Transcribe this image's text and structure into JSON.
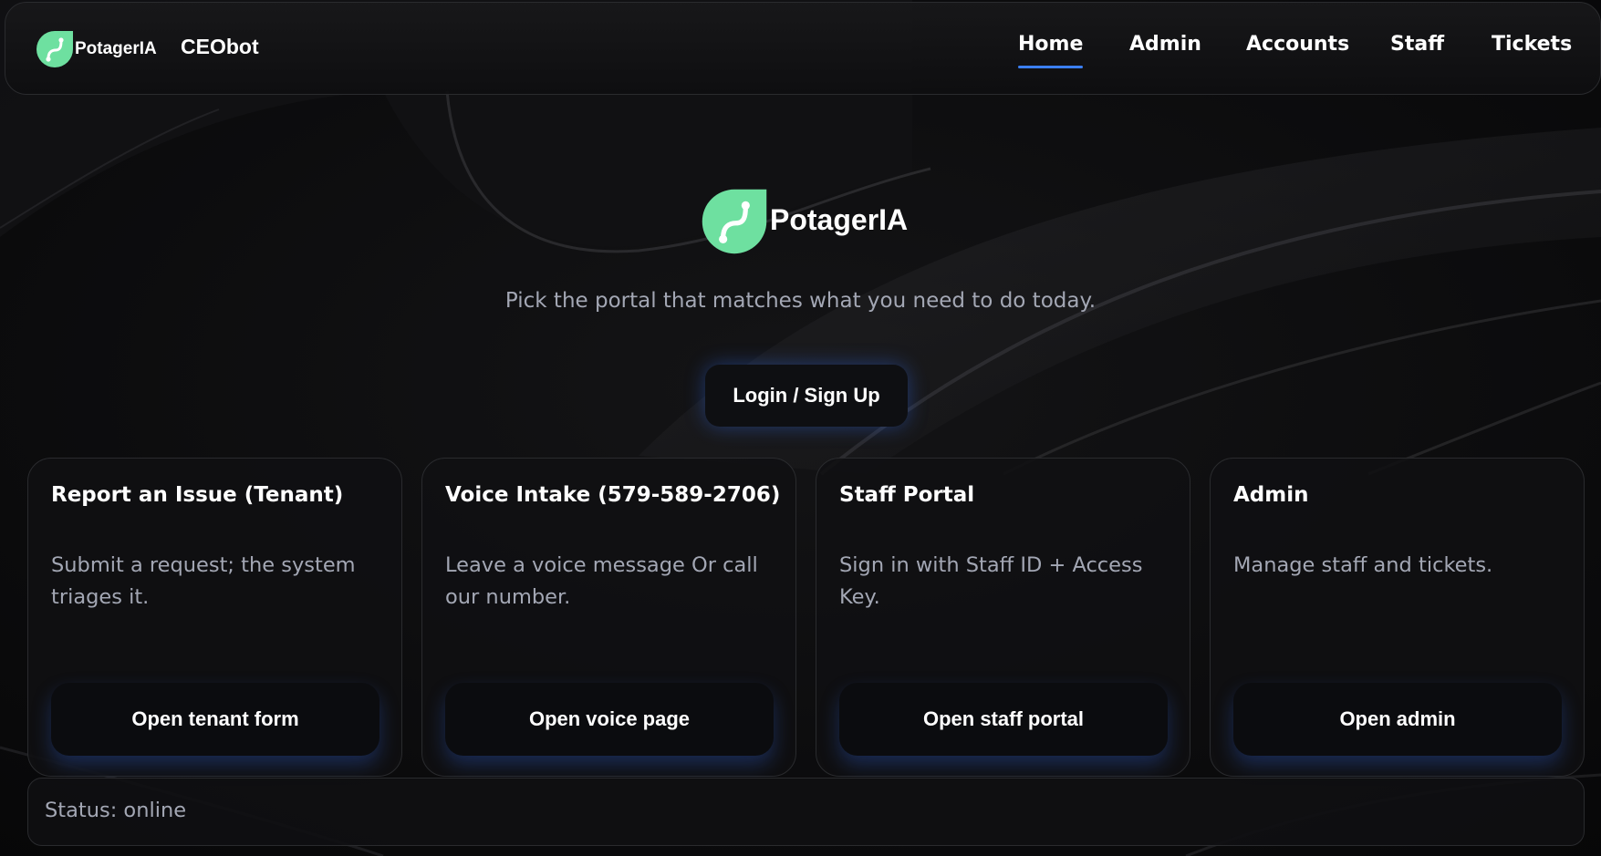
{
  "header": {
    "brand_name": "PotagerIA",
    "app_name": "CEObot",
    "nav": [
      {
        "label": "Home",
        "active": true
      },
      {
        "label": "Admin",
        "active": false
      },
      {
        "label": "Accounts",
        "active": false
      },
      {
        "label": "Staff",
        "active": false
      },
      {
        "label": "Tickets",
        "active": false
      }
    ]
  },
  "hero": {
    "brand_name": "PotagerIA",
    "tagline": "Pick the portal that matches what you need to do today.",
    "login_label": "Login / Sign Up"
  },
  "cards": [
    {
      "title": "Report an Issue (Tenant)",
      "description": "Submit a request; the system triages it.",
      "button": "Open tenant form"
    },
    {
      "title": "Voice Intake (579-589-2706)",
      "description": "Leave a voice message Or call our number.",
      "button": "Open voice page"
    },
    {
      "title": "Staff Portal",
      "description": "Sign in with Staff ID + Access Key.",
      "button": "Open staff portal"
    },
    {
      "title": "Admin",
      "description": "Manage staff and tickets.",
      "button": "Open admin"
    }
  ],
  "status": {
    "text": "Status: online"
  },
  "colors": {
    "accent": "#3b7ff3",
    "logo_green": "#6ee0a0",
    "muted_text": "#a3a7b4",
    "background": "#0b0b0c"
  },
  "icons": {
    "brand_logo": "leaf-sprout-icon"
  }
}
